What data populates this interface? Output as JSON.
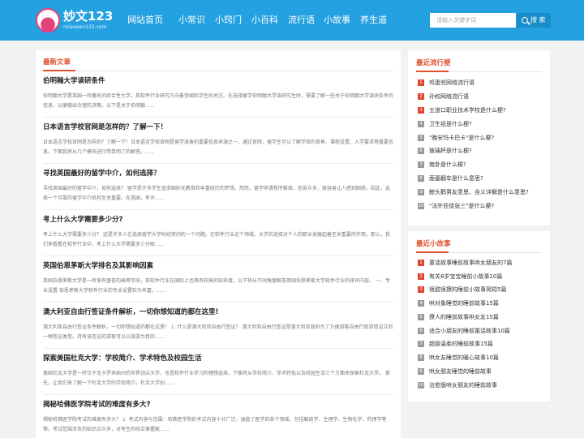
{
  "header": {
    "logo_title": "妙文123",
    "logo_sub": "miaowen123.com",
    "nav": [
      "网站首页",
      "小常识",
      "小窍门",
      "小百科",
      "流行语",
      "小故事",
      "养生道"
    ],
    "search_placeholder": "请输入关键字词",
    "search_label": "搜 索"
  },
  "main": {
    "section_title": "最新文章",
    "articles": [
      {
        "title": "伯明翰大学读研条件",
        "desc": "伯明翰大学是英国一所著名的综合性大学。其软件行业研究方向备受国际学生的关注。在选择留学伯明翰大学读研究生时，需要了解一些关于伯明翰大学读研条件的信息，以便做出合理的决策。以下是关于伯明翰......"
      },
      {
        "title": "日本语言学校官网是怎样的？了解一下！",
        "desc": "日本语言学校官网是怎样的？了解一下！日本语言学校官网是留学准备的重要信息来源之一。通过官网，留学生可以了解学校的背景、课程设置、入学要求等重要信息。下面我将从几个模块进行简单明了的解答。......"
      },
      {
        "title": "寻找英国最好的留学中介，如何选择？",
        "desc": "寻找英国最好的留学中介，如何选择？ 留学是许多学生追求国际化教育和丰富经历的梦想。然而，留学申请程序繁琐，信息众多，很容易让人感到困惑。因此，选择一个可靠的留学中介机构至关重要。在英国，有许......"
      },
      {
        "title": "考上什么大学需要多少分?",
        "desc": "考上什么大学需要多少分？ 这是许多人在选择留学大学时经常问的一个问题。在软件行业这个领域，大学的选择对个人的职业发展起着至关重要的作用。那么，我们来看看在软件行业中，考上什么大学需要多少分呢......"
      },
      {
        "title": "英国伯恩茅斯大学排名及其影响因素",
        "desc": "英国伯恩茅斯大学是一所享有盛誉的高等学府，其软件行业在国际上也具有较高的知名度。以下将从不同角度解答英国伯恩茅斯大学软件行业的排评内容。 一、专业设置 伯恩茅斯大学软件行业的专业设置较为丰富。......"
      },
      {
        "title": "澳大利亚自由行签证条件解析，一切你想知道的都在这里!",
        "desc": "澳大利亚自由行签证条件解析，一切你想知道的都在这里！ 1. 什么是澳大利亚自由行签证？ 澳大利亚自由行签证是澳大利亚政府为了方便游客自由行旅游而设立的一种签证类型。持有该签证的游客可以以旅游为目的......"
      },
      {
        "title": "探索美国杜克大学：学校简介、学术特色及校园生活",
        "desc": "美国杜克大学是一所位于北卡罗来纳州的世界顶尖大学，也是软件行业学习的理想选择。下面将从学校简介、学术特色以及校园生活三个方面来探索杜克大学。 首先，让我们来了解一下杜克大学的学校简介。杜克大学创......"
      },
      {
        "title": "揭秘哈佛医学院考试的难度有多大?",
        "desc": "揭秘哈佛医学院考试的难度有多大？ 1. 考试内容与范围：哈佛医学院的考试内容十分广泛，涵盖了医学的各个领域，包括解剖学、生理学、生物化学、药理学等等。考试范围涉及的知识点众多，对考生的综合掌握能......"
      }
    ]
  },
  "sidebar_popular": {
    "title": "最近流行梗",
    "items": [
      "鸡蛋兜网络流行语",
      "孙权网络流行语",
      "五道口职业技术学校是什么梗?",
      "卫生纸是什么梗?",
      "\"晚安玛卡巴卡\"是什么梗?",
      "玻璃杯是什么梗?",
      "南卦是什么梗?",
      "面基翻车是什么意思?",
      "鲸头鹳男友意思、含义详解是什么意思?",
      "\"法外狂徒张三\"是什么梗?"
    ]
  },
  "sidebar_stories": {
    "title": "最近小故事",
    "items": [
      "童话故事睡前故事哄女朋友的7篇",
      "有关8岁宝宝睡前小故事10篇",
      "很甜很撩的睡前小故事简短5篇",
      "哄对象睡觉的睡前故事15篇",
      "撩人的睡前故事哄女友15篇",
      "适合小朋友的睡前童话故事10篇",
      "超级温柔的睡前故事15篇",
      "哄女友睡觉的暖心故事10篇",
      "哄女朋友睡觉的睡前故事",
      "治愈版哄女朋友的睡前故事"
    ]
  },
  "colors": {
    "header": "#24a1e0",
    "accent": "#e0522e",
    "hot_badge": "#e0452f"
  }
}
